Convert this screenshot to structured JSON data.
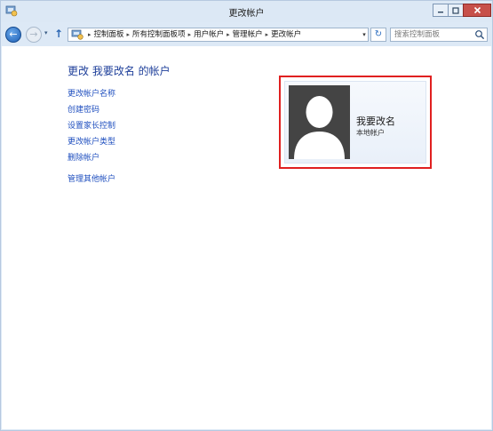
{
  "window": {
    "title": "更改帐户",
    "controls": {
      "minimize": "—",
      "maximize": "□",
      "close": "✕"
    }
  },
  "nav": {
    "back_glyph": "←",
    "forward_glyph": "→",
    "recent_glyph": "▾",
    "up_glyph": "↑",
    "address_icon": "control-panel-icon",
    "breadcrumbs": [
      "控制面板",
      "所有控制面板项",
      "用户帐户",
      "管理帐户",
      "更改帐户"
    ],
    "separator": "▸",
    "dropdown_glyph": "▾",
    "refresh_glyph": "↻",
    "search_placeholder": "搜索控制面板"
  },
  "main": {
    "title": "更改 我要改名 的帐户",
    "links": [
      "更改帐户名称",
      "创建密码",
      "设置家长控制",
      "更改帐户类型",
      "删除帐户"
    ],
    "other_link": "管理其他帐户"
  },
  "account": {
    "name": "我要改名",
    "type": "本地帐户"
  },
  "colors": {
    "link": "#1f4fbf",
    "title": "#1e3f9a",
    "highlight": "#e02020",
    "avatar_bg": "#444444",
    "chrome": "#dce8f5"
  }
}
